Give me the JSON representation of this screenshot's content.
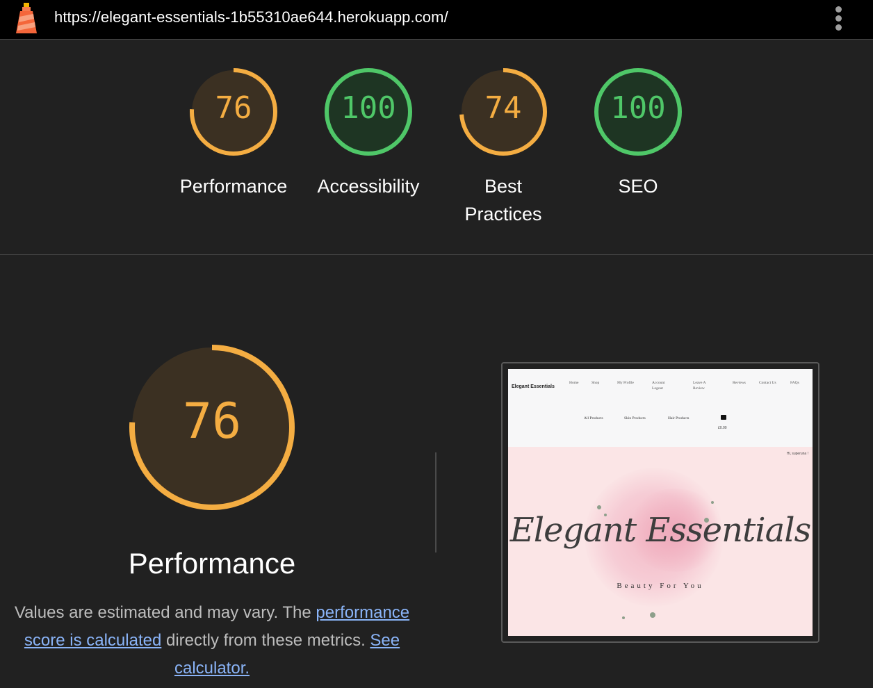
{
  "topbar": {
    "url": "https://elegant-essentials-1b55310ae644.herokuapp.com/",
    "logo_icon": "lighthouse-icon",
    "menu_icon": "more-vert-icon"
  },
  "colors": {
    "average": "#f4ad42",
    "average_bg": "#3b3022",
    "pass": "#4fc768",
    "pass_bg": "#1e3523",
    "background": "#212121",
    "link": "#8ab4f8"
  },
  "scores": [
    {
      "label": "Performance",
      "score": "76",
      "value": 76,
      "rating": "average"
    },
    {
      "label": "Accessibility",
      "score": "100",
      "value": 100,
      "rating": "pass"
    },
    {
      "label_line1": "Best",
      "label_line2": "Practices",
      "score": "74",
      "value": 74,
      "rating": "average"
    },
    {
      "label": "SEO",
      "score": "100",
      "value": 100,
      "rating": "pass"
    }
  ],
  "performance": {
    "score": "76",
    "value": 76,
    "title": "Performance",
    "desc_prefix": "Values are estimated and may vary. The ",
    "desc_link": "performance score is calculated",
    "desc_middle": " directly from these metrics. ",
    "calc_link": "See calculator."
  },
  "screenshot": {
    "brand": "Elegant Essentials",
    "nav": [
      "Home",
      "Shop",
      "My Profile",
      "Account Logout",
      "Leave A Review",
      "Reviews",
      "Contact Us",
      "FAQs"
    ],
    "sub_nav": [
      "All Products",
      "Skin Products",
      "Hair Products"
    ],
    "bag_total": "£0.00",
    "greeting": "Hi, superuna !",
    "hero_title": "Elegant Essentials",
    "hero_tagline": "Beauty For You"
  }
}
